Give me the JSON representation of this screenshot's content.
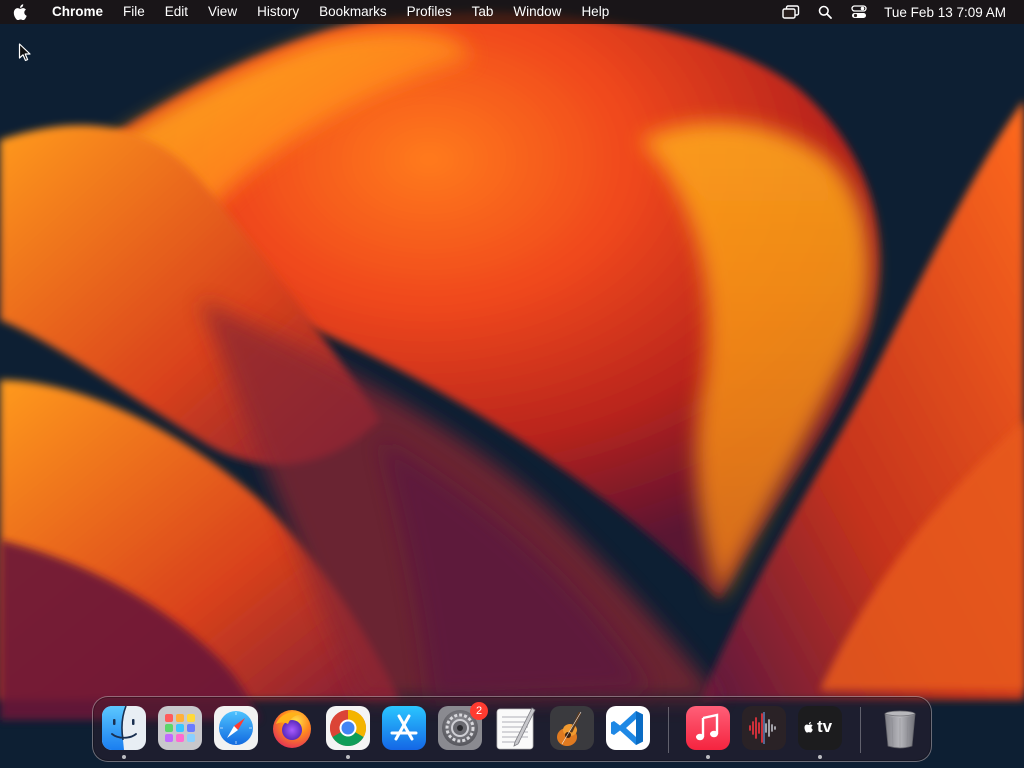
{
  "menubar": {
    "app_name": "Chrome",
    "menus": [
      "File",
      "Edit",
      "View",
      "History",
      "Bookmarks",
      "Profiles",
      "Tab",
      "Window",
      "Help"
    ],
    "clock": "Tue Feb 13  7:09 AM"
  },
  "dock": {
    "apps": [
      {
        "name": "Finder",
        "icon": "finder-icon",
        "running": true
      },
      {
        "name": "Launchpad",
        "icon": "launchpad-icon",
        "running": false
      },
      {
        "name": "Safari",
        "icon": "safari-icon",
        "running": false
      },
      {
        "name": "Firefox",
        "icon": "firefox-icon",
        "running": false
      },
      {
        "name": "Google Chrome",
        "icon": "chrome-icon",
        "running": true
      },
      {
        "name": "App Store",
        "icon": "app-store-icon",
        "running": false
      },
      {
        "name": "System Settings",
        "icon": "system-settings-icon",
        "running": false,
        "badge": "2"
      },
      {
        "name": "TextEdit",
        "icon": "textedit-icon",
        "running": false
      },
      {
        "name": "GarageBand",
        "icon": "garageband-icon",
        "running": false
      },
      {
        "name": "Visual Studio Code",
        "icon": "vscode-icon",
        "running": false
      },
      {
        "name": "Music",
        "icon": "music-icon",
        "running": true
      },
      {
        "name": "Voice Memos",
        "icon": "voice-memos-icon",
        "running": false
      },
      {
        "name": "TV",
        "icon": "apple-tv-icon",
        "running": true
      },
      {
        "name": "Trash",
        "icon": "trash-icon",
        "running": false
      }
    ],
    "tv_label": "tv"
  },
  "colors": {
    "wallpaper_dark": "#0d1f33",
    "wallpaper_orange": "#f26a1b",
    "wallpaper_yellow": "#ffb21a",
    "wallpaper_purple": "#5a1740"
  }
}
